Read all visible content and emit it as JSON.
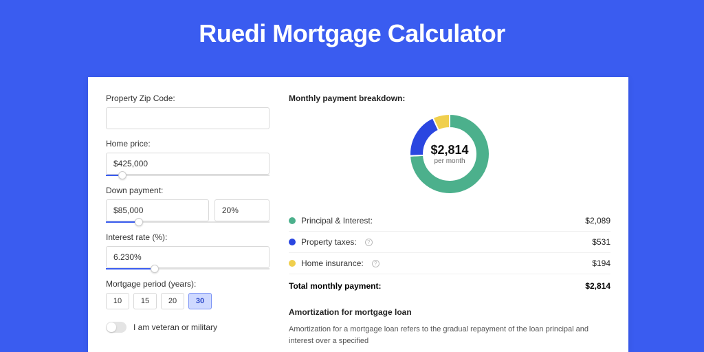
{
  "title": "Ruedi Mortgage Calculator",
  "form": {
    "zip": {
      "label": "Property Zip Code:",
      "value": ""
    },
    "price": {
      "label": "Home price:",
      "value": "$425,000",
      "sliderPercent": 10
    },
    "down": {
      "label": "Down payment:",
      "amount": "$85,000",
      "percent": "20%",
      "sliderPercent": 20
    },
    "rate": {
      "label": "Interest rate (%):",
      "value": "6.230%",
      "sliderPercent": 30
    },
    "period": {
      "label": "Mortgage period (years):",
      "options": [
        "10",
        "15",
        "20",
        "30"
      ],
      "active": "30"
    },
    "veteran": {
      "label": "I am veteran or military",
      "on": false
    }
  },
  "breakdown": {
    "title": "Monthly payment breakdown:",
    "center": {
      "value": "$2,814",
      "sub": "per month"
    },
    "rows": [
      {
        "label": "Principal & Interest:",
        "value": "$2,089",
        "color": "#4cb08c",
        "info": false
      },
      {
        "label": "Property taxes:",
        "value": "$531",
        "color": "#2a46e0",
        "info": true
      },
      {
        "label": "Home insurance:",
        "value": "$194",
        "color": "#f0cf4d",
        "info": true
      }
    ],
    "total": {
      "label": "Total monthly payment:",
      "value": "$2,814"
    }
  },
  "amort": {
    "title": "Amortization for mortgage loan",
    "text": "Amortization for a mortgage loan refers to the gradual repayment of the loan principal and interest over a specified"
  },
  "chart_data": {
    "type": "pie",
    "title": "Monthly payment breakdown",
    "categories": [
      "Principal & Interest",
      "Property taxes",
      "Home insurance"
    ],
    "values": [
      2089,
      531,
      194
    ],
    "colors": [
      "#4cb08c",
      "#2a46e0",
      "#f0cf4d"
    ],
    "total": 2814,
    "center_label": "$2,814 per month"
  }
}
